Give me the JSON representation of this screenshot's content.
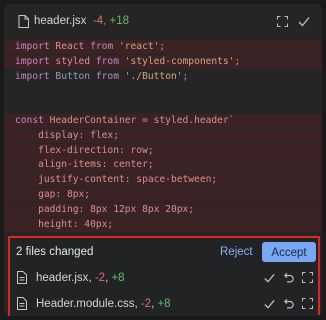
{
  "header": {
    "file_name": "header.jsx",
    "deletions": "-4",
    "additions": "+18",
    "sep": ","
  },
  "code_lines": [
    {
      "parts": [
        {
          "t": "import",
          "c": "kw"
        },
        {
          "t": " React "
        },
        {
          "t": "from",
          "c": "kw"
        },
        {
          "t": " "
        },
        {
          "t": "'react'",
          "c": "str"
        },
        {
          "t": ";"
        }
      ],
      "kind": "removed"
    },
    {
      "parts": [
        {
          "t": "import",
          "c": "kw"
        },
        {
          "t": " styled "
        },
        {
          "t": "from",
          "c": "kw"
        },
        {
          "t": " "
        },
        {
          "t": "'styled-components'",
          "c": "str"
        },
        {
          "t": ";"
        }
      ],
      "kind": "removed"
    },
    {
      "parts": [
        {
          "t": "import",
          "c": "kw"
        },
        {
          "t": " Button "
        },
        {
          "t": "from",
          "c": "kw"
        },
        {
          "t": " "
        },
        {
          "t": "'./Button'",
          "c": "str"
        },
        {
          "t": ";"
        }
      ],
      "kind": "plain"
    },
    {
      "parts": [],
      "kind": "blank"
    },
    {
      "parts": [],
      "kind": "blank"
    },
    {
      "parts": [
        {
          "t": "const",
          "c": "kw"
        },
        {
          "t": " HeaderContainer = styled.header`"
        }
      ],
      "kind": "removed"
    },
    {
      "parts": [
        {
          "t": "    display: flex;"
        }
      ],
      "kind": "removed"
    },
    {
      "parts": [
        {
          "t": "    flex-direction: row;"
        }
      ],
      "kind": "removed"
    },
    {
      "parts": [
        {
          "t": "    align-items: center;"
        }
      ],
      "kind": "removed"
    },
    {
      "parts": [
        {
          "t": "    justify-content: space-between;"
        }
      ],
      "kind": "removed"
    },
    {
      "parts": [
        {
          "t": "    gap: 8px;"
        }
      ],
      "kind": "removed"
    },
    {
      "parts": [
        {
          "t": "    padding: 8px 12px 8px 20px;"
        }
      ],
      "kind": "removed"
    },
    {
      "parts": [
        {
          "t": "    height: 40px;"
        }
      ],
      "kind": "removed"
    }
  ],
  "footer": {
    "summary": "2 files changed",
    "reject_label": "Reject",
    "accept_label": "Accept",
    "files": [
      {
        "name": "header.jsx",
        "sep": ", ",
        "deletions": "-2",
        "comma": ", ",
        "additions": "+8"
      },
      {
        "name": "Header.module.css",
        "sep": ", ",
        "deletions": "-2",
        "comma": ", ",
        "additions": "+8"
      }
    ]
  },
  "colors": {
    "accent": "#7aa7f5",
    "removed_bg": "#3b2325",
    "highlight_border": "#e0231c",
    "additions": "#5fbf6a",
    "deletions": "#e06c6c"
  }
}
